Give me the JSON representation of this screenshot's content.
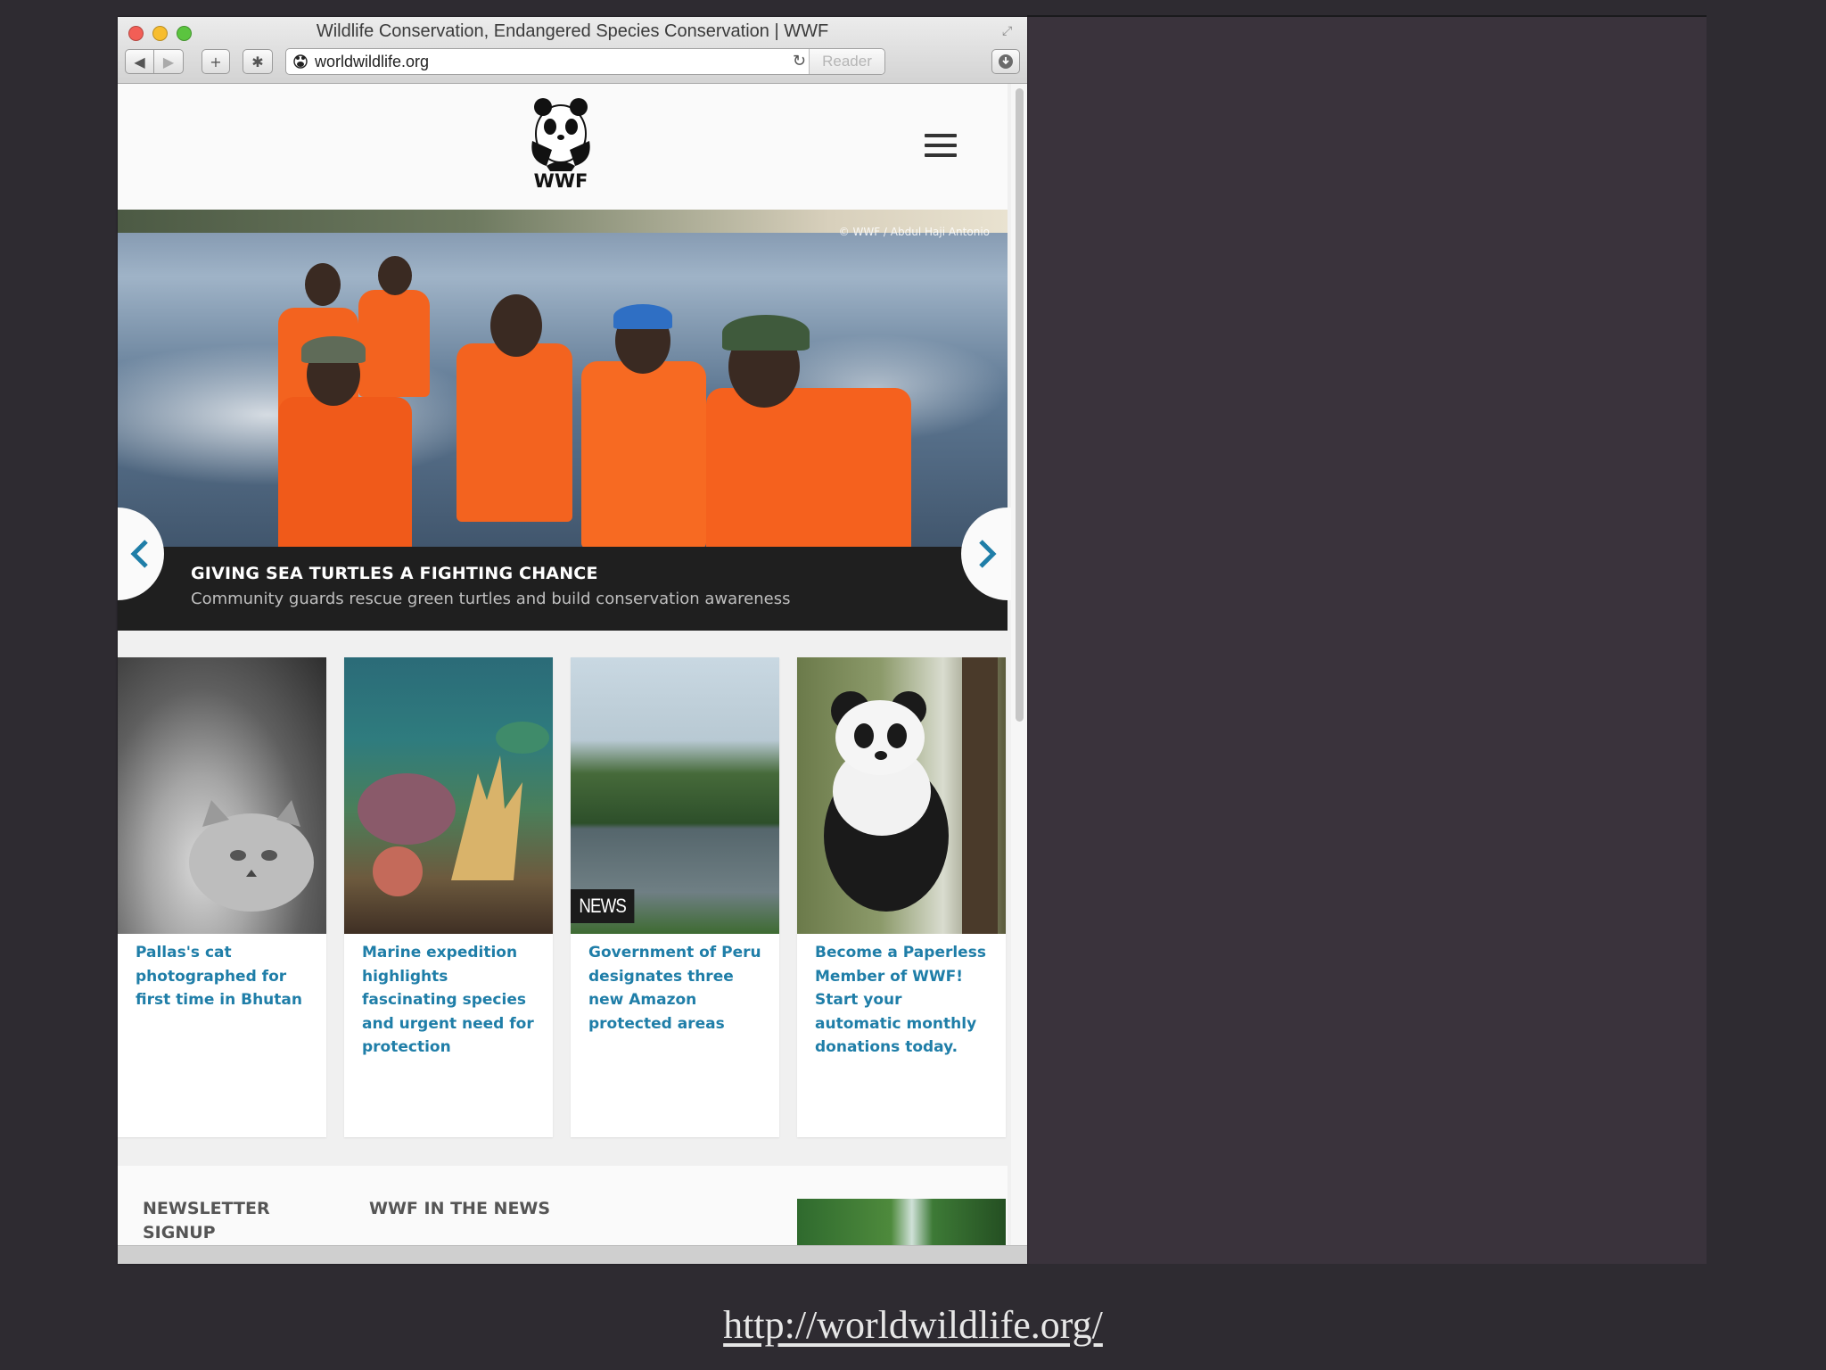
{
  "browser": {
    "window_title": "Wildlife Conservation, Endangered Species Conservation | WWF",
    "address": "worldwildlife.org",
    "reader_label": "Reader"
  },
  "site": {
    "logo_text": "WWF",
    "hero": {
      "credit": "© WWF / Abdul Haji Antonio",
      "title": "GIVING SEA TURTLES A FIGHTING CHANCE",
      "subtitle": "Community guards rescue green turtles and build conservation awareness"
    },
    "cards": [
      {
        "text": "Pallas's cat photographed for first time in Bhutan"
      },
      {
        "text": "Marine expedition highlights fascinating species and urgent need for protection"
      },
      {
        "text": "Government of Peru designates three new Amazon protected areas",
        "badge": "NEWS"
      },
      {
        "text": "Become a Paperless Member of WWF! Start your automatic monthly donations today."
      }
    ],
    "bottom": {
      "newsletter": "NEWSLETTER SIGNUP",
      "in_the_news": "WWF IN THE NEWS"
    }
  },
  "slide_caption": "http://worldwildlife.org/",
  "colors": {
    "link_blue": "#1f7ea8",
    "caption_bar": "#1f1f1f",
    "slide_background": "#2e2b31"
  }
}
